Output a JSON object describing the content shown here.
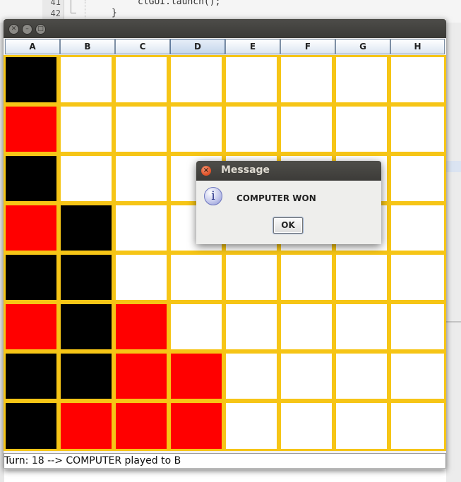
{
  "editor": {
    "line_numbers": [
      "41",
      "42"
    ],
    "code_line": "clGUI.launch();",
    "closing_brace": "}"
  },
  "window": {
    "title": "",
    "columns": [
      "A",
      "B",
      "C",
      "D",
      "E",
      "F",
      "G",
      "H"
    ],
    "hover_column": "D",
    "colors": {
      "player": "#ff0000",
      "computer": "#000000",
      "empty": "#ffffff",
      "grid": "#f6c516"
    },
    "board": [
      [
        "black",
        "empty",
        "empty",
        "empty",
        "empty",
        "empty",
        "empty",
        "empty"
      ],
      [
        "red",
        "empty",
        "empty",
        "empty",
        "empty",
        "empty",
        "empty",
        "empty"
      ],
      [
        "black",
        "empty",
        "empty",
        "empty",
        "empty",
        "empty",
        "empty",
        "empty"
      ],
      [
        "red",
        "black",
        "empty",
        "empty",
        "empty",
        "empty",
        "empty",
        "empty"
      ],
      [
        "black",
        "black",
        "empty",
        "empty",
        "empty",
        "empty",
        "empty",
        "empty"
      ],
      [
        "red",
        "black",
        "red",
        "empty",
        "empty",
        "empty",
        "empty",
        "empty"
      ],
      [
        "black",
        "black",
        "red",
        "red",
        "empty",
        "empty",
        "empty",
        "empty"
      ],
      [
        "black",
        "red",
        "red",
        "red",
        "empty",
        "empty",
        "empty",
        "empty"
      ]
    ],
    "status": "Turn: 18 --> COMPUTER played to B"
  },
  "dialog": {
    "title": "Message",
    "icon": "info-icon",
    "message": "COMPUTER WON",
    "ok_label": "OK"
  }
}
